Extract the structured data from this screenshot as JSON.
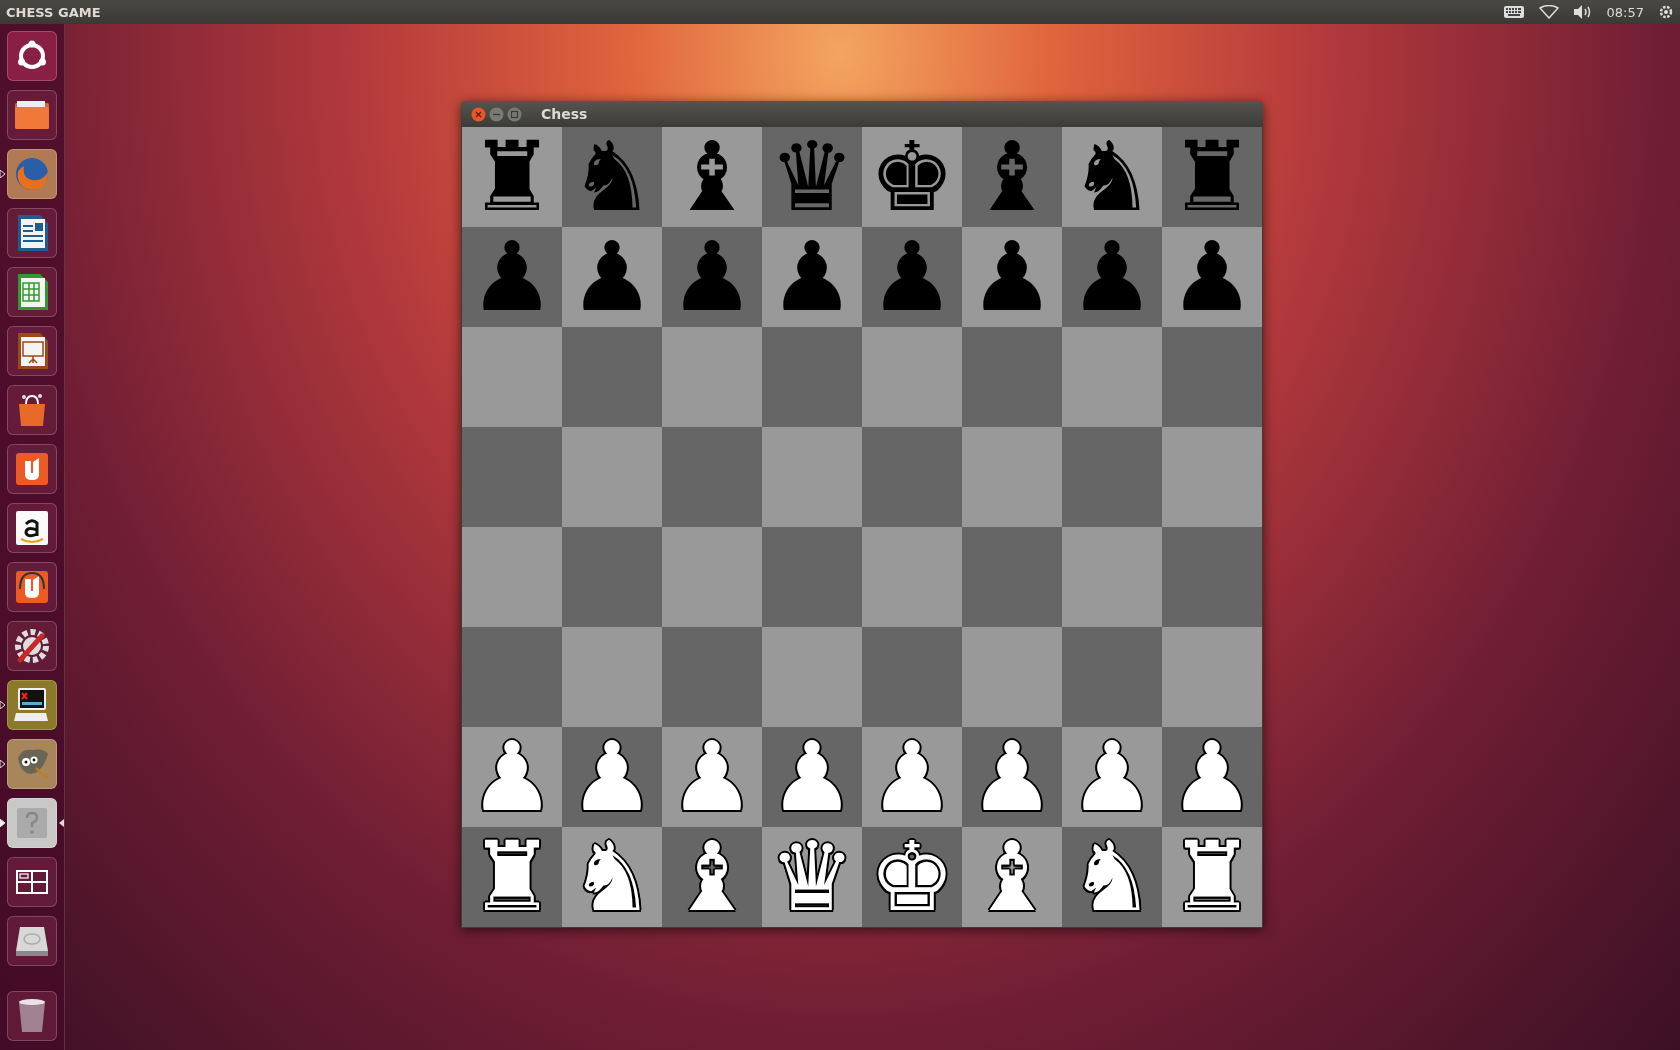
{
  "top_bar": {
    "title": "CHESS GAME",
    "time": "08:57"
  },
  "launcher": [
    {
      "kind": "ubuntu",
      "running": false,
      "active": false
    },
    {
      "kind": "folder",
      "running": false,
      "active": false
    },
    {
      "kind": "browser",
      "running": true,
      "active": false
    },
    {
      "kind": "writer",
      "running": false,
      "active": false
    },
    {
      "kind": "calc",
      "running": false,
      "active": false
    },
    {
      "kind": "impress",
      "running": false,
      "active": false
    },
    {
      "kind": "bag",
      "running": false,
      "active": false
    },
    {
      "kind": "u",
      "running": false,
      "active": false
    },
    {
      "kind": "amazon",
      "running": false,
      "active": false
    },
    {
      "kind": "music",
      "running": false,
      "active": false
    },
    {
      "kind": "settings",
      "running": false,
      "active": false
    },
    {
      "kind": "terminal",
      "running": true,
      "active": false
    },
    {
      "kind": "gimp",
      "running": true,
      "active": false
    },
    {
      "kind": "help",
      "running": true,
      "active": true
    },
    {
      "kind": "workspaces",
      "running": false,
      "active": false
    },
    {
      "kind": "drive",
      "running": false,
      "active": false
    },
    {
      "kind": "trash",
      "running": false,
      "active": false
    }
  ],
  "window": {
    "title": "Chess"
  },
  "board": {
    "rows": [
      [
        {
          "piece": "♜",
          "color": "#000000"
        },
        {
          "piece": "♞",
          "color": "#000000"
        },
        {
          "piece": "♝",
          "color": "#000000"
        },
        {
          "piece": "♛",
          "color": "#000000"
        },
        {
          "piece": "♚",
          "color": "#000000"
        },
        {
          "piece": "♝",
          "color": "#000000"
        },
        {
          "piece": "♞",
          "color": "#000000"
        },
        {
          "piece": "♜",
          "color": "#000000"
        }
      ],
      [
        {
          "piece": "♟",
          "color": "#000000"
        },
        {
          "piece": "♟",
          "color": "#000000"
        },
        {
          "piece": "♟",
          "color": "#000000"
        },
        {
          "piece": "♟",
          "color": "#000000"
        },
        {
          "piece": "♟",
          "color": "#000000"
        },
        {
          "piece": "♟",
          "color": "#000000"
        },
        {
          "piece": "♟",
          "color": "#000000"
        },
        {
          "piece": "♟",
          "color": "#000000"
        }
      ],
      [
        {},
        {},
        {},
        {},
        {},
        {},
        {},
        {}
      ],
      [
        {},
        {},
        {},
        {},
        {},
        {},
        {},
        {}
      ],
      [
        {},
        {},
        {},
        {},
        {},
        {},
        {},
        {}
      ],
      [
        {},
        {},
        {},
        {},
        {},
        {},
        {},
        {}
      ],
      [
        {
          "piece": "♟",
          "color": "#ffffff"
        },
        {
          "piece": "♟",
          "color": "#ffffff"
        },
        {
          "piece": "♟",
          "color": "#ffffff"
        },
        {
          "piece": "♟",
          "color": "#ffffff"
        },
        {
          "piece": "♟",
          "color": "#ffffff"
        },
        {
          "piece": "♟",
          "color": "#ffffff"
        },
        {
          "piece": "♟",
          "color": "#ffffff"
        },
        {
          "piece": "♟",
          "color": "#ffffff"
        }
      ],
      [
        {
          "piece": "♜",
          "color": "#ffffff"
        },
        {
          "piece": "♞",
          "color": "#ffffff"
        },
        {
          "piece": "♝",
          "color": "#ffffff"
        },
        {
          "piece": "♛",
          "color": "#ffffff"
        },
        {
          "piece": "♚",
          "color": "#ffffff"
        },
        {
          "piece": "♝",
          "color": "#ffffff"
        },
        {
          "piece": "♞",
          "color": "#ffffff"
        },
        {
          "piece": "♜",
          "color": "#ffffff"
        }
      ]
    ]
  }
}
